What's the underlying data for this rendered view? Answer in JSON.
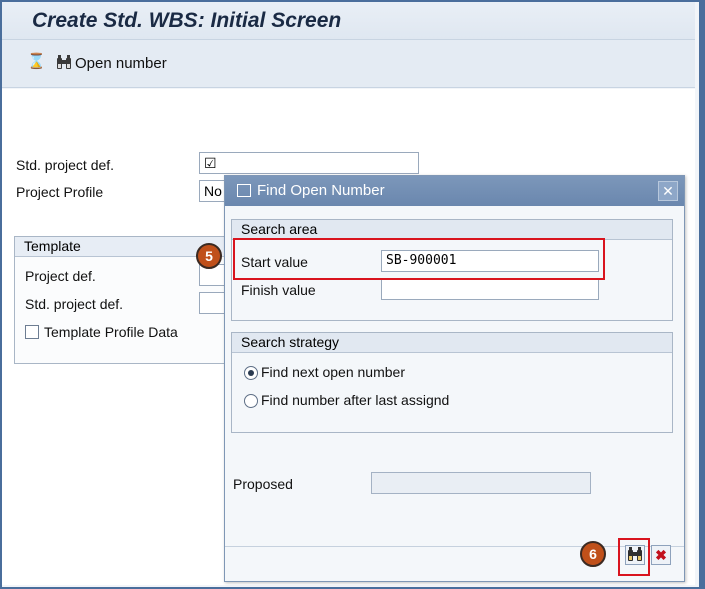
{
  "window": {
    "title": "Create Std. WBS: Initial Screen"
  },
  "toolbar": {
    "open_number_label": "Open number"
  },
  "form": {
    "std_project_def_label": "Std. project def.",
    "std_project_def_value": "☑",
    "project_profile_label": "Project Profile",
    "project_profile_value": "No"
  },
  "template": {
    "heading": "Template",
    "project_def_label": "Project def.",
    "std_project_def_label": "Std. project def.",
    "profile_data_label": "Template Profile Data"
  },
  "dialog": {
    "title": "Find Open Number",
    "search_area": {
      "heading": "Search area",
      "start_label": "Start value",
      "start_value": "SB-900001",
      "finish_label": "Finish value",
      "finish_value": ""
    },
    "search_strategy": {
      "heading": "Search strategy",
      "options": [
        "Find next open number",
        "Find number after last assignd"
      ],
      "selected": "Find next open number"
    },
    "proposed_label": "Proposed",
    "proposed_value": "",
    "cancel_icon": "✖"
  },
  "annotations": {
    "step5": "5",
    "step6": "6"
  },
  "colors": {
    "highlight": "#d9141e",
    "badge": "#c0501a",
    "dialog_title": "#6a87ae"
  }
}
